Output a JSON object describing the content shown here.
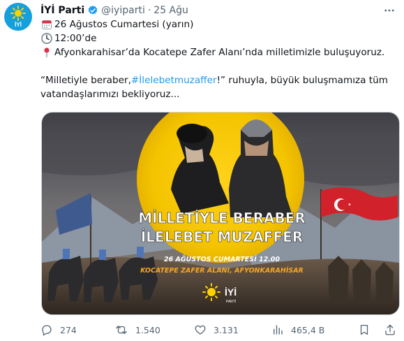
{
  "tweet": {
    "display_name": "İYİ Parti",
    "handle": "@iyiparti",
    "separator": "·",
    "date": "25 Ağu",
    "lines": [
      "26 Ağustos Cumartesi (yarın)",
      "12:00’de",
      "Afyonkarahisar’da Kocatepe Zafer Alanı’nda milletimizle buluşuyoruz."
    ],
    "quote_open": "“Milletiyle beraber, ",
    "hashtag": "#İlelebetmuzaffer",
    "quote_rest": "!” ruhuyla, büyük buluşmamıza tüm",
    "quote_line2": "vatandaşlarımızı bekliyoruz..."
  },
  "avatar": {
    "logo_text": "İYİ",
    "icon": "sun-logo-icon"
  },
  "poster": {
    "headline_1": "MİLLETİYLE BERABER",
    "headline_2": "İLELEBET MUZAFFER",
    "date_time": "26 AĞUSTOS CUMARTESİ 12.00",
    "location": "KOCATEPE ZAFER ALANI, AFYONKARAHİSAR",
    "logo_text": "İYİ",
    "logo_sub": "PARTİ"
  },
  "actions": {
    "replies": "274",
    "reposts": "1.540",
    "likes": "3.131",
    "views": "465,4 B"
  },
  "colors": {
    "accent": "#1d9bf0",
    "brand": "#14a0dc",
    "poster_yellow": "#f2c500",
    "poster_orange": "#f6a623"
  }
}
